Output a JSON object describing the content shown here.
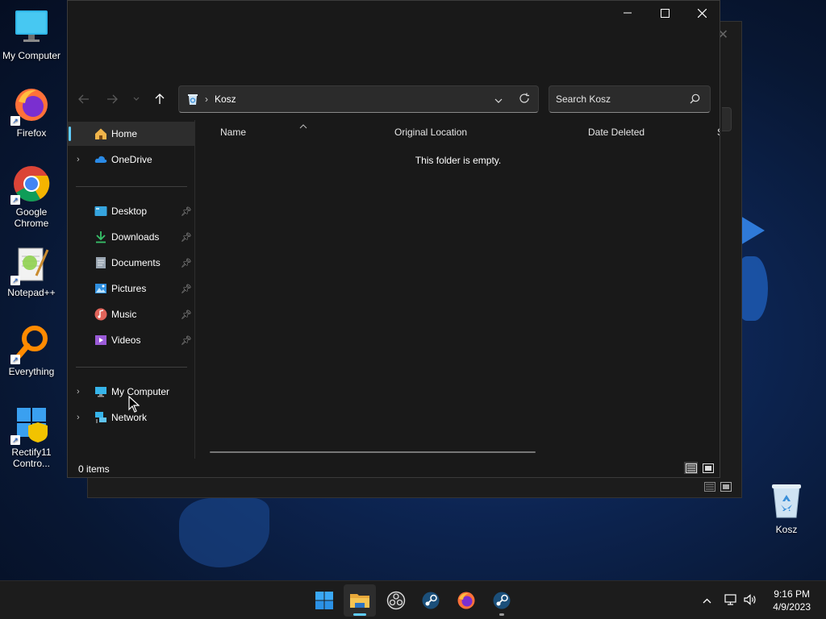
{
  "desktop": {
    "icons": [
      {
        "label": "My Computer"
      },
      {
        "label": "Firefox"
      },
      {
        "label": "Google Chrome"
      },
      {
        "label": "Notepad++"
      },
      {
        "label": "Everything"
      },
      {
        "label": "Rectify11 Contro..."
      },
      {
        "label": "Kosz"
      }
    ]
  },
  "explorer": {
    "window_controls": {
      "minimize": "—",
      "maximize": "☐",
      "close": "✕"
    },
    "address": {
      "location": "Kosz"
    },
    "search": {
      "placeholder": "Search Kosz"
    },
    "sidebar": {
      "items": [
        {
          "label": "Home"
        },
        {
          "label": "OneDrive"
        },
        {
          "label": "Desktop"
        },
        {
          "label": "Downloads"
        },
        {
          "label": "Documents"
        },
        {
          "label": "Pictures"
        },
        {
          "label": "Music"
        },
        {
          "label": "Videos"
        },
        {
          "label": "My Computer"
        },
        {
          "label": "Network"
        }
      ]
    },
    "columns": [
      {
        "label": "Name"
      },
      {
        "label": "Original Location"
      },
      {
        "label": "Date Deleted"
      },
      {
        "label": "S"
      }
    ],
    "empty_message": "This folder is empty.",
    "status": "0 items"
  },
  "taskbar": {
    "clock": {
      "time": "9:16 PM",
      "date": "4/9/2023"
    }
  },
  "colors": {
    "accent": "#60cdff",
    "window_bg": "#191919",
    "taskbar_bg": "#1c1c1c"
  }
}
